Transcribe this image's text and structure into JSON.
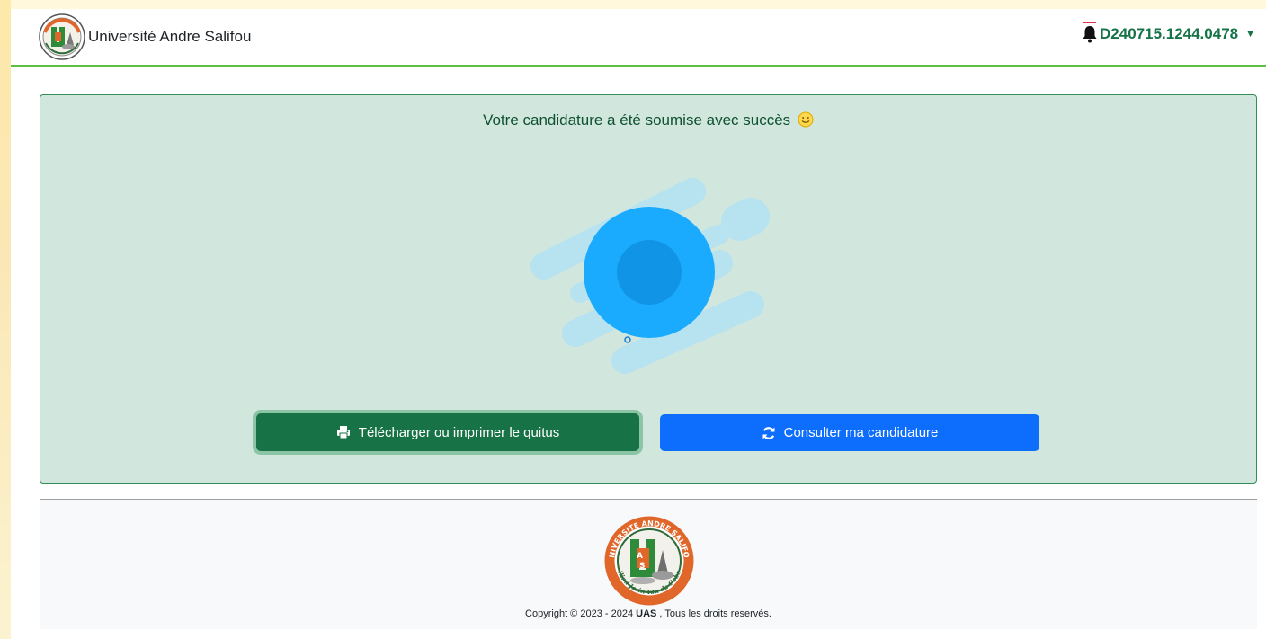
{
  "header": {
    "brand_name": "Université Andre Salifou",
    "user_id": "D240715.1244.0478"
  },
  "alert": {
    "message": "Votre candidature a été soumise avec succès"
  },
  "actions": {
    "print_label": "Télécharger ou imprimer le quitus",
    "consult_label": "Consulter ma candidature"
  },
  "footer": {
    "copyright_prefix": "Copyright © 2023 - 2024",
    "copyright_org": "UAS",
    "copyright_suffix": ", Tous les droits reservés.",
    "logo_text_top": "UNIVERSITE ANDRE SALIFOU",
    "logo_letters": "UAS",
    "logo_motto": "Ilimi Jarin Yau da Gobe"
  },
  "colors": {
    "brand_green": "#157347",
    "nav_border": "#5cc045",
    "alert_bg": "#d1e7dd",
    "primary_blue": "#0d6efd",
    "illustration_blue": "#1aa7ff"
  },
  "icons": {
    "bell": "bell-icon",
    "caret": "caret-down-icon",
    "print": "printer-icon",
    "refresh": "refresh-icon",
    "smiley": "smiley-icon"
  }
}
